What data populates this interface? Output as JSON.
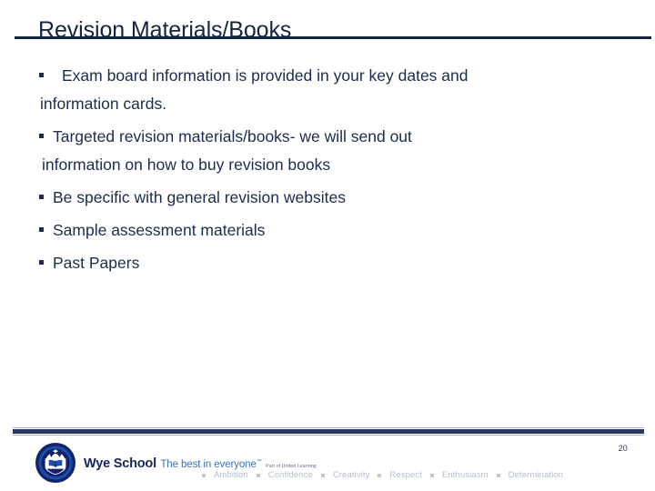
{
  "slide": {
    "title": "Revision Materials/Books",
    "page_number": "20",
    "accent_color": "#15243f",
    "body_text_color": "#1b2c4e",
    "footer_rule_color": "#2b3566"
  },
  "bullets": [
    {
      "id": "bullet-exam-board",
      "marker": "square-bullet",
      "line1": " Exam board information is provided in your key dates and",
      "line2": "information cards."
    },
    {
      "id": "bullet-targeted-revision",
      "marker": "square-bullet",
      "line1": "Targeted revision materials/books- we will send out",
      "line2": "information on how to buy revision books"
    },
    {
      "id": "bullet-be-specific",
      "marker": "square-bullet",
      "line1": "Be specific with general revision websites",
      "line2": ""
    },
    {
      "id": "bullet-sample-assessment",
      "marker": "square-bullet",
      "line1": "Sample assessment materials",
      "line2": ""
    },
    {
      "id": "bullet-past-papers",
      "marker": "square-bullet",
      "line1": "Past Papers",
      "line2": ""
    }
  ],
  "footer": {
    "logo": {
      "icon": "school-crest-icon",
      "name": "Wye School",
      "tagline": "The best in everyone",
      "trademark": "™",
      "sub": "Part of United Learning"
    },
    "values": [
      "Ambition",
      "Confidence",
      "Creativity",
      "Respect",
      "Enthusiasm",
      "Determination"
    ]
  }
}
